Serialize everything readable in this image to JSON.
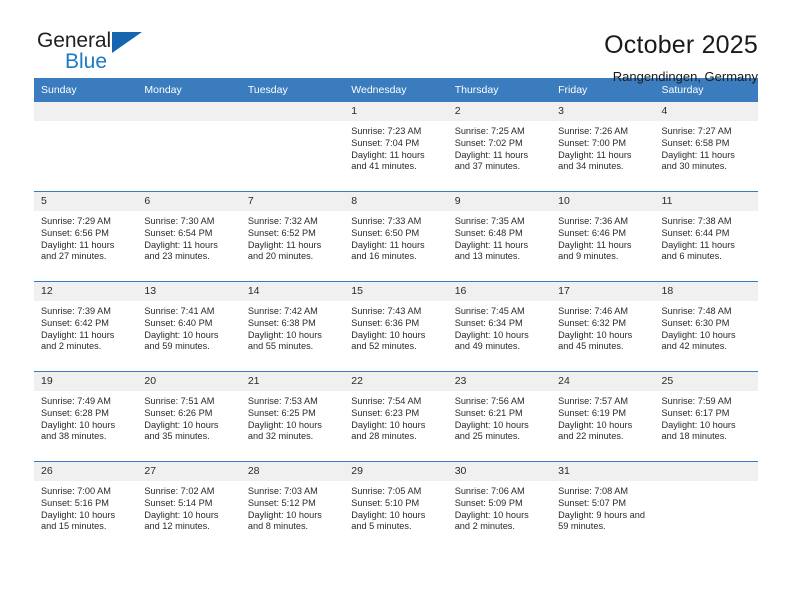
{
  "logo": {
    "line1": "General",
    "line2": "Blue",
    "triangle_color": "#1565b0",
    "blue_text_color": "#1b7ac4"
  },
  "header": {
    "title": "October 2025",
    "subtitle": "Rangendingen, Germany",
    "accent_color": "#3a7cbe",
    "daynum_band_color": "#f0f0f0"
  },
  "calendar": {
    "weekday_headers": [
      "Sunday",
      "Monday",
      "Tuesday",
      "Wednesday",
      "Thursday",
      "Friday",
      "Saturday"
    ],
    "weeks": [
      [
        {
          "day": "",
          "blank": true
        },
        {
          "day": "",
          "blank": true
        },
        {
          "day": "",
          "blank": true
        },
        {
          "day": "1",
          "sunrise": "Sunrise: 7:23 AM",
          "sunset": "Sunset: 7:04 PM",
          "daylight": "Daylight: 11 hours and 41 minutes."
        },
        {
          "day": "2",
          "sunrise": "Sunrise: 7:25 AM",
          "sunset": "Sunset: 7:02 PM",
          "daylight": "Daylight: 11 hours and 37 minutes."
        },
        {
          "day": "3",
          "sunrise": "Sunrise: 7:26 AM",
          "sunset": "Sunset: 7:00 PM",
          "daylight": "Daylight: 11 hours and 34 minutes."
        },
        {
          "day": "4",
          "sunrise": "Sunrise: 7:27 AM",
          "sunset": "Sunset: 6:58 PM",
          "daylight": "Daylight: 11 hours and 30 minutes."
        }
      ],
      [
        {
          "day": "5",
          "sunrise": "Sunrise: 7:29 AM",
          "sunset": "Sunset: 6:56 PM",
          "daylight": "Daylight: 11 hours and 27 minutes."
        },
        {
          "day": "6",
          "sunrise": "Sunrise: 7:30 AM",
          "sunset": "Sunset: 6:54 PM",
          "daylight": "Daylight: 11 hours and 23 minutes."
        },
        {
          "day": "7",
          "sunrise": "Sunrise: 7:32 AM",
          "sunset": "Sunset: 6:52 PM",
          "daylight": "Daylight: 11 hours and 20 minutes."
        },
        {
          "day": "8",
          "sunrise": "Sunrise: 7:33 AM",
          "sunset": "Sunset: 6:50 PM",
          "daylight": "Daylight: 11 hours and 16 minutes."
        },
        {
          "day": "9",
          "sunrise": "Sunrise: 7:35 AM",
          "sunset": "Sunset: 6:48 PM",
          "daylight": "Daylight: 11 hours and 13 minutes."
        },
        {
          "day": "10",
          "sunrise": "Sunrise: 7:36 AM",
          "sunset": "Sunset: 6:46 PM",
          "daylight": "Daylight: 11 hours and 9 minutes."
        },
        {
          "day": "11",
          "sunrise": "Sunrise: 7:38 AM",
          "sunset": "Sunset: 6:44 PM",
          "daylight": "Daylight: 11 hours and 6 minutes."
        }
      ],
      [
        {
          "day": "12",
          "sunrise": "Sunrise: 7:39 AM",
          "sunset": "Sunset: 6:42 PM",
          "daylight": "Daylight: 11 hours and 2 minutes."
        },
        {
          "day": "13",
          "sunrise": "Sunrise: 7:41 AM",
          "sunset": "Sunset: 6:40 PM",
          "daylight": "Daylight: 10 hours and 59 minutes."
        },
        {
          "day": "14",
          "sunrise": "Sunrise: 7:42 AM",
          "sunset": "Sunset: 6:38 PM",
          "daylight": "Daylight: 10 hours and 55 minutes."
        },
        {
          "day": "15",
          "sunrise": "Sunrise: 7:43 AM",
          "sunset": "Sunset: 6:36 PM",
          "daylight": "Daylight: 10 hours and 52 minutes."
        },
        {
          "day": "16",
          "sunrise": "Sunrise: 7:45 AM",
          "sunset": "Sunset: 6:34 PM",
          "daylight": "Daylight: 10 hours and 49 minutes."
        },
        {
          "day": "17",
          "sunrise": "Sunrise: 7:46 AM",
          "sunset": "Sunset: 6:32 PM",
          "daylight": "Daylight: 10 hours and 45 minutes."
        },
        {
          "day": "18",
          "sunrise": "Sunrise: 7:48 AM",
          "sunset": "Sunset: 6:30 PM",
          "daylight": "Daylight: 10 hours and 42 minutes."
        }
      ],
      [
        {
          "day": "19",
          "sunrise": "Sunrise: 7:49 AM",
          "sunset": "Sunset: 6:28 PM",
          "daylight": "Daylight: 10 hours and 38 minutes."
        },
        {
          "day": "20",
          "sunrise": "Sunrise: 7:51 AM",
          "sunset": "Sunset: 6:26 PM",
          "daylight": "Daylight: 10 hours and 35 minutes."
        },
        {
          "day": "21",
          "sunrise": "Sunrise: 7:53 AM",
          "sunset": "Sunset: 6:25 PM",
          "daylight": "Daylight: 10 hours and 32 minutes."
        },
        {
          "day": "22",
          "sunrise": "Sunrise: 7:54 AM",
          "sunset": "Sunset: 6:23 PM",
          "daylight": "Daylight: 10 hours and 28 minutes."
        },
        {
          "day": "23",
          "sunrise": "Sunrise: 7:56 AM",
          "sunset": "Sunset: 6:21 PM",
          "daylight": "Daylight: 10 hours and 25 minutes."
        },
        {
          "day": "24",
          "sunrise": "Sunrise: 7:57 AM",
          "sunset": "Sunset: 6:19 PM",
          "daylight": "Daylight: 10 hours and 22 minutes."
        },
        {
          "day": "25",
          "sunrise": "Sunrise: 7:59 AM",
          "sunset": "Sunset: 6:17 PM",
          "daylight": "Daylight: 10 hours and 18 minutes."
        }
      ],
      [
        {
          "day": "26",
          "sunrise": "Sunrise: 7:00 AM",
          "sunset": "Sunset: 5:16 PM",
          "daylight": "Daylight: 10 hours and 15 minutes."
        },
        {
          "day": "27",
          "sunrise": "Sunrise: 7:02 AM",
          "sunset": "Sunset: 5:14 PM",
          "daylight": "Daylight: 10 hours and 12 minutes."
        },
        {
          "day": "28",
          "sunrise": "Sunrise: 7:03 AM",
          "sunset": "Sunset: 5:12 PM",
          "daylight": "Daylight: 10 hours and 8 minutes."
        },
        {
          "day": "29",
          "sunrise": "Sunrise: 7:05 AM",
          "sunset": "Sunset: 5:10 PM",
          "daylight": "Daylight: 10 hours and 5 minutes."
        },
        {
          "day": "30",
          "sunrise": "Sunrise: 7:06 AM",
          "sunset": "Sunset: 5:09 PM",
          "daylight": "Daylight: 10 hours and 2 minutes."
        },
        {
          "day": "31",
          "sunrise": "Sunrise: 7:08 AM",
          "sunset": "Sunset: 5:07 PM",
          "daylight": "Daylight: 9 hours and 59 minutes."
        },
        {
          "day": "",
          "blank": true
        }
      ]
    ]
  }
}
